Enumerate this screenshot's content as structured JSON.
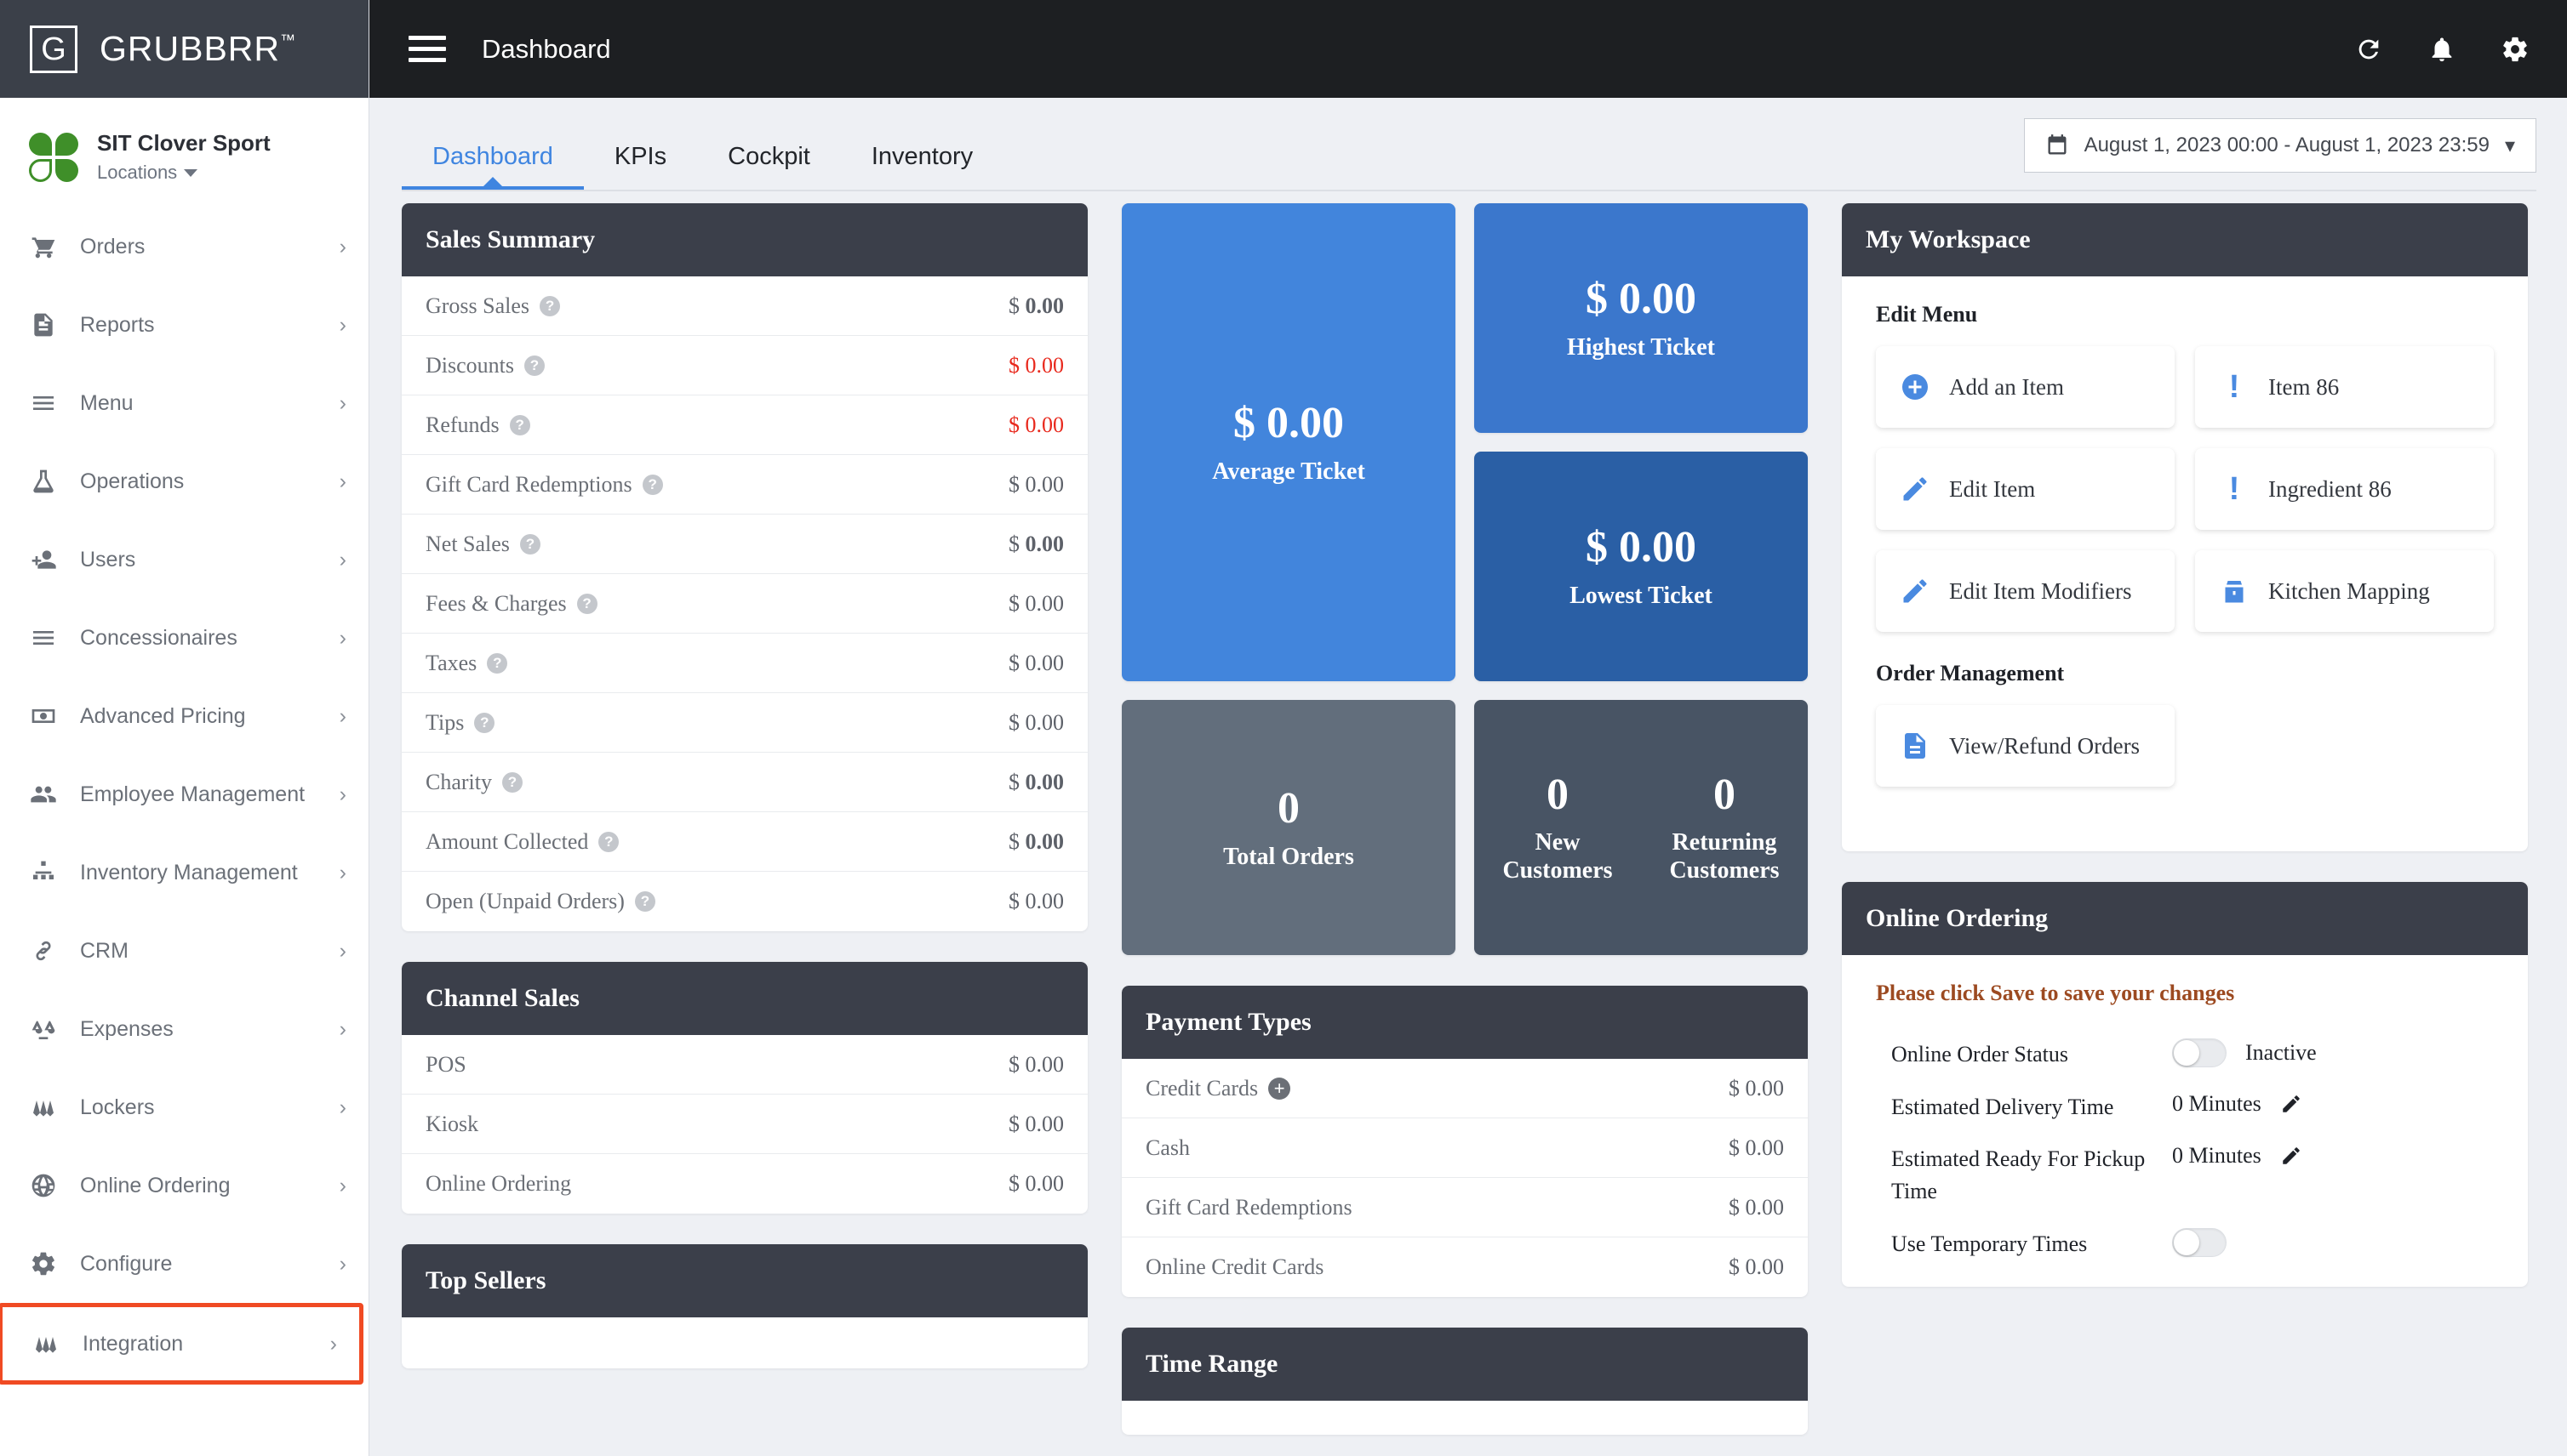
{
  "brand": {
    "mark": "G",
    "name": "GRUBBRR",
    "tm": "™"
  },
  "location": {
    "name": "SIT Clover Sport",
    "sublabel": "Locations"
  },
  "sidebar": {
    "items": [
      {
        "label": "Orders",
        "icon": "cart-icon",
        "chevron": "›"
      },
      {
        "label": "Reports",
        "icon": "document-icon",
        "chevron": "›"
      },
      {
        "label": "Menu",
        "icon": "list-icon",
        "chevron": "›"
      },
      {
        "label": "Operations",
        "icon": "flask-icon",
        "chevron": "›"
      },
      {
        "label": "Users",
        "icon": "user-add-icon",
        "chevron": "›"
      },
      {
        "label": "Concessionaires",
        "icon": "list-icon",
        "chevron": "›"
      },
      {
        "label": "Advanced Pricing",
        "icon": "money-icon",
        "chevron": "›"
      },
      {
        "label": "Employee Management",
        "icon": "people-icon",
        "chevron": "›"
      },
      {
        "label": "Inventory Management",
        "icon": "sitemap-icon",
        "chevron": "›"
      },
      {
        "label": "CRM",
        "icon": "link-icon",
        "chevron": "›"
      },
      {
        "label": "Expenses",
        "icon": "scales-icon",
        "chevron": "›"
      },
      {
        "label": "Lockers",
        "icon": "locker-icon",
        "chevron": "›"
      },
      {
        "label": "Online Ordering",
        "icon": "globe-icon",
        "chevron": "›"
      },
      {
        "label": "Configure",
        "icon": "gear-icon",
        "chevron": "›"
      },
      {
        "label": "Integration",
        "icon": "locker-icon",
        "chevron": "›",
        "highlighted": true
      }
    ]
  },
  "topbar": {
    "title": "Dashboard",
    "menu_icon": "hamburger-icon",
    "icons": [
      "refresh-icon",
      "bell-icon",
      "gear-icon"
    ]
  },
  "tabs": [
    {
      "label": "Dashboard",
      "active": true
    },
    {
      "label": "KPIs",
      "active": false
    },
    {
      "label": "Cockpit",
      "active": false
    },
    {
      "label": "Inventory",
      "active": false
    }
  ],
  "date_range": {
    "icon": "calendar-icon",
    "value": "August 1, 2023 00:00 - August 1, 2023 23:59",
    "caret": "▾"
  },
  "sales_summary": {
    "title": "Sales Summary",
    "rows": [
      {
        "label": "Gross Sales",
        "help": true,
        "value_prefix": "$",
        "value": "0.00",
        "bold": true,
        "red": false
      },
      {
        "label": "Discounts",
        "help": true,
        "value_prefix": "$",
        "value": "0.00",
        "bold": false,
        "red": true
      },
      {
        "label": "Refunds",
        "help": true,
        "value_prefix": "$",
        "value": "0.00",
        "bold": false,
        "red": true
      },
      {
        "label": "Gift Card Redemptions",
        "help": true,
        "value_prefix": "$",
        "value": "0.00",
        "bold": false,
        "red": false
      },
      {
        "label": "Net Sales",
        "help": true,
        "value_prefix": "$",
        "value": "0.00",
        "bold": true,
        "red": false
      },
      {
        "label": "Fees & Charges",
        "help": true,
        "value_prefix": "$",
        "value": "0.00",
        "bold": false,
        "red": false
      },
      {
        "label": "Taxes",
        "help": true,
        "value_prefix": "$",
        "value": "0.00",
        "bold": false,
        "red": false
      },
      {
        "label": "Tips",
        "help": true,
        "value_prefix": "$",
        "value": "0.00",
        "bold": false,
        "red": false
      },
      {
        "label": "Charity",
        "help": true,
        "value_prefix": "$",
        "value": "0.00",
        "bold": true,
        "red": false
      },
      {
        "label": "Amount Collected",
        "help": true,
        "value_prefix": "$",
        "value": "0.00",
        "bold": true,
        "red": false
      },
      {
        "label": "Open (Unpaid Orders)",
        "help": true,
        "value_prefix": "$",
        "value": "0.00",
        "bold": false,
        "red": false
      }
    ]
  },
  "kpi_tiles": {
    "average_ticket": {
      "prefix": "$",
      "value": "0.00",
      "caption": "Average Ticket",
      "color": "#4285dc"
    },
    "highest_ticket": {
      "prefix": "$",
      "value": "0.00",
      "caption": "Highest Ticket",
      "color": "#3b77cc"
    },
    "lowest_ticket": {
      "prefix": "$",
      "value": "0.00",
      "caption": "Lowest Ticket",
      "color": "#2a5fa5"
    },
    "total_orders": {
      "value": "0",
      "caption": "Total Orders",
      "color": "#626e7c"
    },
    "customers": {
      "color": "#485464",
      "new": {
        "value": "0",
        "caption_line1": "New",
        "caption_line2": "Customers"
      },
      "returning": {
        "value": "0",
        "caption_line1": "Returning",
        "caption_line2": "Customers"
      }
    }
  },
  "workspace": {
    "title": "My Workspace",
    "edit_menu": {
      "section_label": "Edit Menu",
      "buttons": [
        {
          "label": "Add an Item",
          "icon": "plus-circle-icon"
        },
        {
          "label": "Item 86",
          "icon": "exclamation-icon"
        },
        {
          "label": "Edit Item",
          "icon": "pencil-icon"
        },
        {
          "label": "Ingredient 86",
          "icon": "exclamation-icon"
        },
        {
          "label": "Edit Item Modifiers",
          "icon": "pencil-icon"
        },
        {
          "label": "Kitchen Mapping",
          "icon": "kitchen-icon"
        }
      ]
    },
    "order_management": {
      "section_label": "Order Management",
      "buttons": [
        {
          "label": "View/Refund Orders",
          "icon": "file-lines-icon"
        }
      ]
    }
  },
  "channel_sales": {
    "title": "Channel Sales",
    "rows": [
      {
        "label": "POS",
        "value_prefix": "$",
        "value": "0.00"
      },
      {
        "label": "Kiosk",
        "value_prefix": "$",
        "value": "0.00"
      },
      {
        "label": "Online Ordering",
        "value_prefix": "$",
        "value": "0.00"
      }
    ]
  },
  "top_sellers": {
    "title": "Top Sellers"
  },
  "payment_types": {
    "title": "Payment Types",
    "rows": [
      {
        "label": "Credit Cards",
        "plus": true,
        "value_prefix": "$",
        "value": "0.00"
      },
      {
        "label": "Cash",
        "plus": false,
        "value_prefix": "$",
        "value": "0.00"
      },
      {
        "label": "Gift Card Redemptions",
        "plus": false,
        "value_prefix": "$",
        "value": "0.00"
      },
      {
        "label": "Online Credit Cards",
        "plus": false,
        "value_prefix": "$",
        "value": "0.00"
      }
    ]
  },
  "time_range": {
    "title": "Time Range"
  },
  "online_ordering": {
    "title": "Online Ordering",
    "warning": "Please click Save to save your changes",
    "rows": [
      {
        "label": "Online Order Status",
        "type": "toggle",
        "state": "off",
        "status_text": "Inactive"
      },
      {
        "label": "Estimated Delivery Time",
        "type": "value",
        "value": "0 Minutes",
        "edit_icon": "pencil-icon"
      },
      {
        "label": "Estimated Ready For Pickup Time",
        "type": "value",
        "value": "0 Minutes",
        "edit_icon": "pencil-icon"
      },
      {
        "label": "Use Temporary Times",
        "type": "toggle",
        "state": "off",
        "status_text": ""
      }
    ]
  }
}
